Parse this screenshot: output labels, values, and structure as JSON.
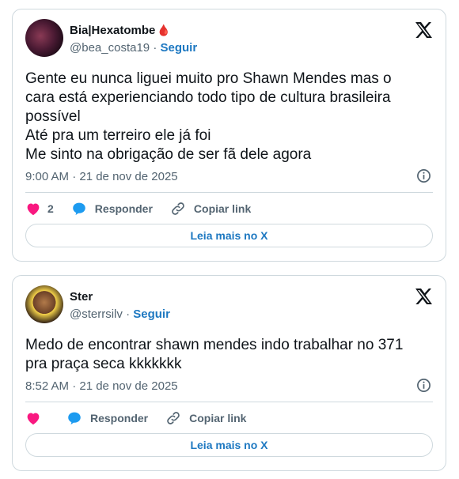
{
  "tweets": [
    {
      "author_name": "Bia|Hexatombe",
      "author_badge": "🩸",
      "handle": "@bea_costa19",
      "separator": "·",
      "follow_label": "Seguir",
      "text_lines": [
        "Gente eu nunca liguei muito pro Shawn Mendes mas o",
        "cara está experienciando todo tipo de cultura brasileira",
        "possível",
        "Até pra um terreiro ele já foi",
        "Me sinto na obrigação de ser fã dele agora"
      ],
      "timestamp": "9:00 AM · 21 de nov de 2025",
      "like_count": "2",
      "reply_label": "Responder",
      "copy_label": "Copiar link",
      "read_more_label": "Leia mais no X"
    },
    {
      "author_name": "Ster",
      "handle": "@sterrsilv",
      "separator": "·",
      "follow_label": "Seguir",
      "text_lines": [
        "Medo de encontrar shawn mendes indo trabalhar no 371",
        "pra praça seca kkkkkkk"
      ],
      "timestamp": "8:52 AM · 21 de nov de 2025",
      "reply_label": "Responder",
      "copy_label": "Copiar link",
      "read_more_label": "Leia mais no X"
    }
  ],
  "colors": {
    "link": "#1d78c1",
    "heart": "#f91880",
    "reply_bubble": "#1d9bf0",
    "muted": "#536471",
    "border": "#cfd9de"
  },
  "icons": [
    "x-logo-icon",
    "info-icon",
    "heart-icon",
    "reply-icon",
    "link-icon"
  ]
}
